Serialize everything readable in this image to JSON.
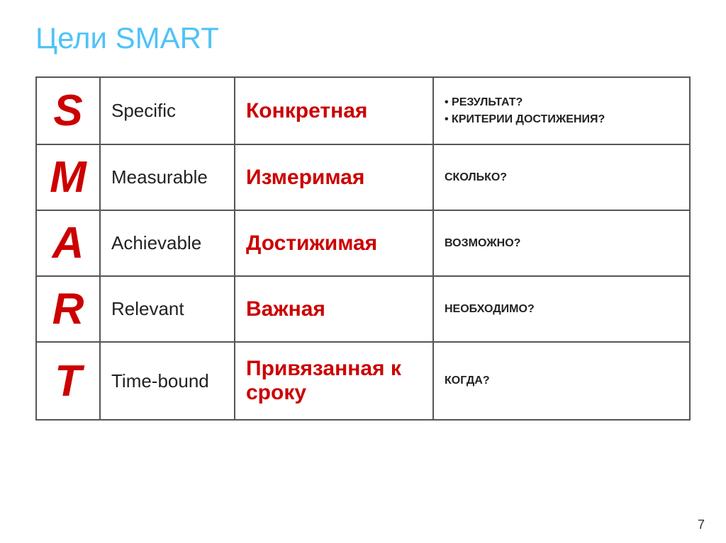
{
  "title": "Цели SMART",
  "table": {
    "rows": [
      {
        "letter": "S",
        "english": "Specific",
        "russian": "Конкретная",
        "description": "• РЕЗУЛЬТАТ?\n• КРИТЕРИИ ДОСТИЖЕНИЯ?"
      },
      {
        "letter": "M",
        "english": "Measurable",
        "russian": "Измеримая",
        "description": "СКОЛЬКО?"
      },
      {
        "letter": "A",
        "english": "Achievable",
        "russian": "Достижимая",
        "description": "ВОЗМОЖНО?"
      },
      {
        "letter": "R",
        "english": "Relevant",
        "russian": "Важная",
        "description": "НЕОБХОДИМО?"
      },
      {
        "letter": "T",
        "english": "Time-bound",
        "russian": "Привязанная к сроку",
        "description": "КОГДА?"
      }
    ]
  },
  "page_number": "7"
}
